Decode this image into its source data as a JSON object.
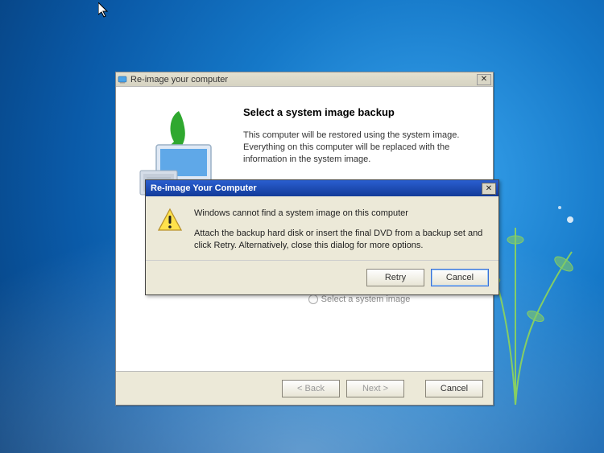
{
  "main_window": {
    "title": "Re-image your computer",
    "heading": "Select a system image backup",
    "description": "This computer will be restored using the system image. Everything on this computer will be replaced with the information in the system image.",
    "radio_label": "Select a system image",
    "buttons": {
      "back": "< Back",
      "next": "Next >",
      "cancel": "Cancel"
    }
  },
  "error_dialog": {
    "title": "Re-image Your Computer",
    "message_1": "Windows cannot find a system image on this computer",
    "message_2": "Attach the backup hard disk or insert the final DVD from a backup set and click Retry. Alternatively, close this dialog for more options.",
    "buttons": {
      "retry": "Retry",
      "cancel": "Cancel"
    }
  }
}
